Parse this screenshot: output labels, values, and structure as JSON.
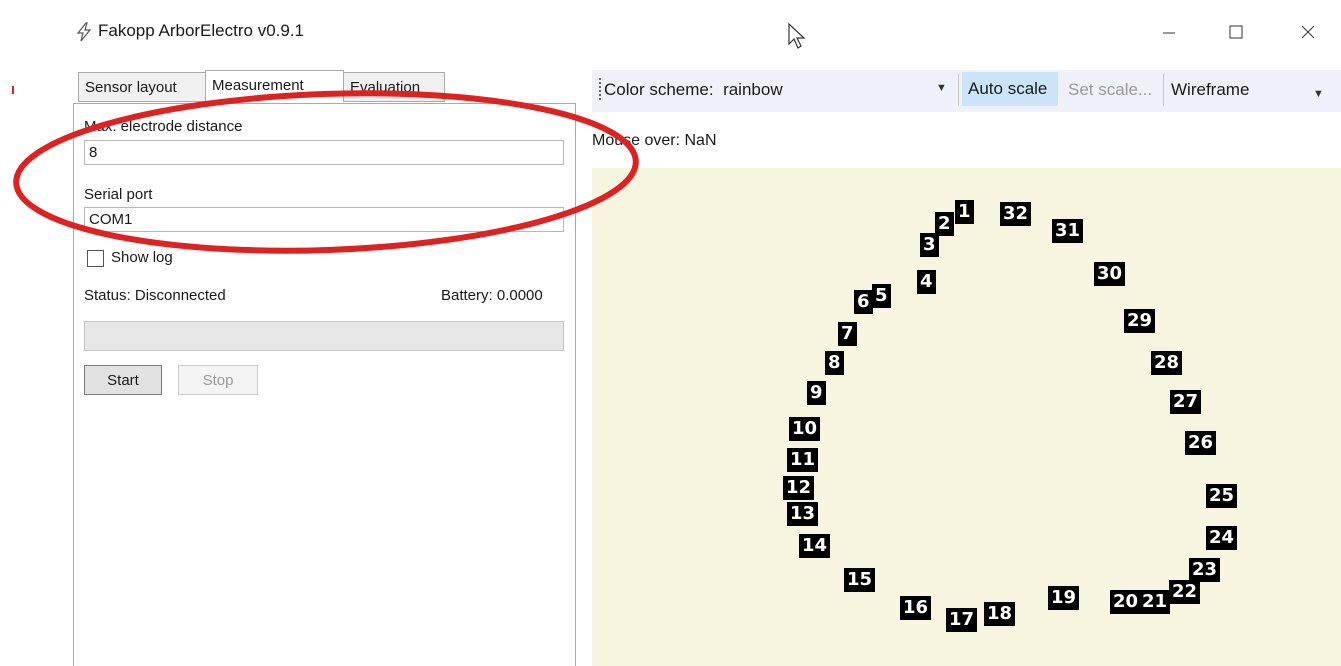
{
  "window": {
    "title": "Fakopp ArborElectro v0.9.1",
    "icon": "lightning-icon",
    "controls": [
      "minimize-icon",
      "maximize-icon",
      "close-icon"
    ]
  },
  "tabs": [
    {
      "label": "Sensor layout",
      "active": false
    },
    {
      "label": "Measurement",
      "active": true
    },
    {
      "label": "Evaluation",
      "active": false
    }
  ],
  "measurement": {
    "max_distance_label": "Max. electrode distance",
    "max_distance_value": "8",
    "serial_port_label": "Serial port",
    "serial_port_value": "COM1",
    "show_log_label": "Show log",
    "show_log_checked": false,
    "status_text": "Status: Disconnected",
    "battery_text": "Battery: 0.0000",
    "progress": 0,
    "start_label": "Start",
    "stop_label": "Stop"
  },
  "toolbar": {
    "color_scheme_label": "Color scheme:",
    "color_scheme_value": "rainbow",
    "auto_scale_label": "Auto scale",
    "set_scale_label": "Set scale...",
    "wireframe_label": "Wireframe"
  },
  "mouse_over_text": "Mouse over: NaN",
  "sensors": [
    "1",
    "2",
    "3",
    "4",
    "5",
    "6",
    "7",
    "8",
    "9",
    "10",
    "11",
    "12",
    "13",
    "14",
    "15",
    "16",
    "17",
    "18",
    "19",
    "20",
    "21",
    "22",
    "23",
    "24",
    "25",
    "26",
    "27",
    "28",
    "29",
    "30",
    "31",
    "32"
  ],
  "colors": {
    "plot_background": "#f7f5df",
    "sensor_badge": "#000000",
    "annotation": "#dd2222",
    "toolbar_active": "#cce4f7"
  }
}
